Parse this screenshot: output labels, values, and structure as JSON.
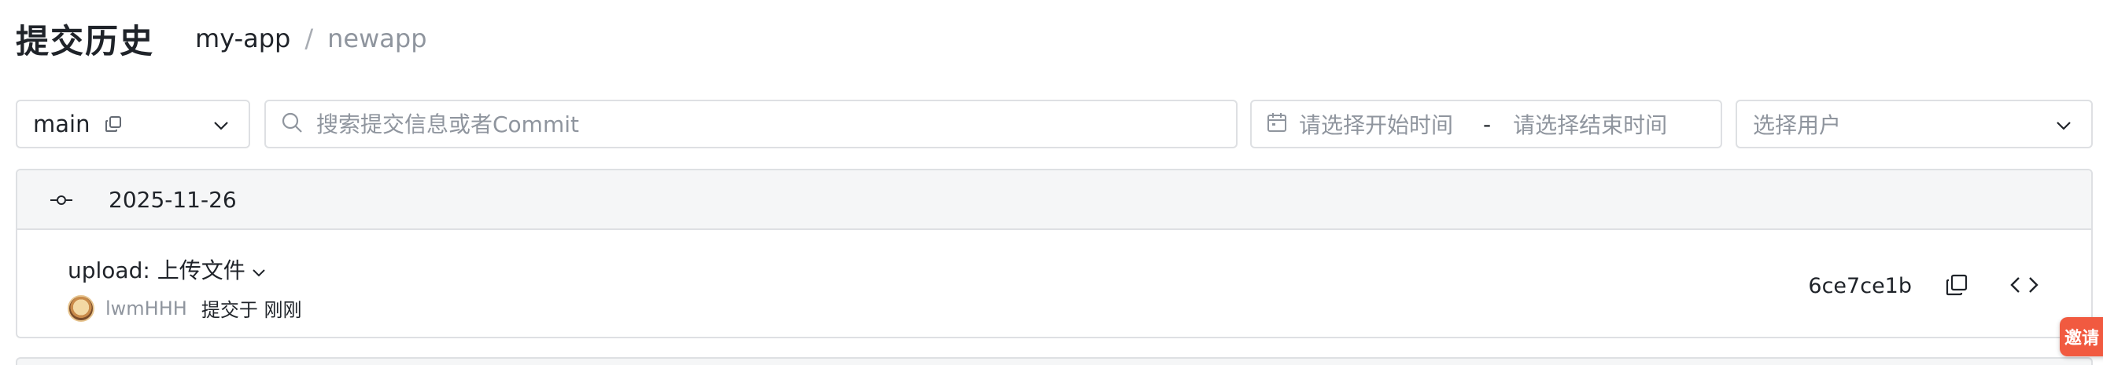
{
  "header": {
    "title": "提交历史",
    "repo": "my-app",
    "separator": "/",
    "branch": "newapp"
  },
  "filters": {
    "branch": {
      "value": "main",
      "icons": [
        "copy-icon",
        "chevron-down-icon"
      ]
    },
    "search": {
      "placeholder": "搜索提交信息或者Commit",
      "icon": "search-icon"
    },
    "date_range": {
      "start_placeholder": "请选择开始时间",
      "separator": "-",
      "end_placeholder": "请选择结束时间",
      "icon": "calendar-icon"
    },
    "user": {
      "placeholder": "选择用户",
      "icon": "chevron-down-icon"
    }
  },
  "commit_groups": [
    {
      "date": "2025-11-26",
      "icon": "commit-node-icon",
      "commits": [
        {
          "message": "upload: 上传文件",
          "author": "lwmHHH",
          "committed": "提交于 刚刚",
          "sha": "6ce7ce1b",
          "actions": [
            "copy-icon",
            "code-icon"
          ]
        }
      ]
    }
  ],
  "floating": {
    "invite_label": "邀请"
  },
  "colors": {
    "border": "#dee0e3",
    "group_bg": "#f5f6f7",
    "placeholder": "#8f959e",
    "invite": "#f15a40"
  }
}
